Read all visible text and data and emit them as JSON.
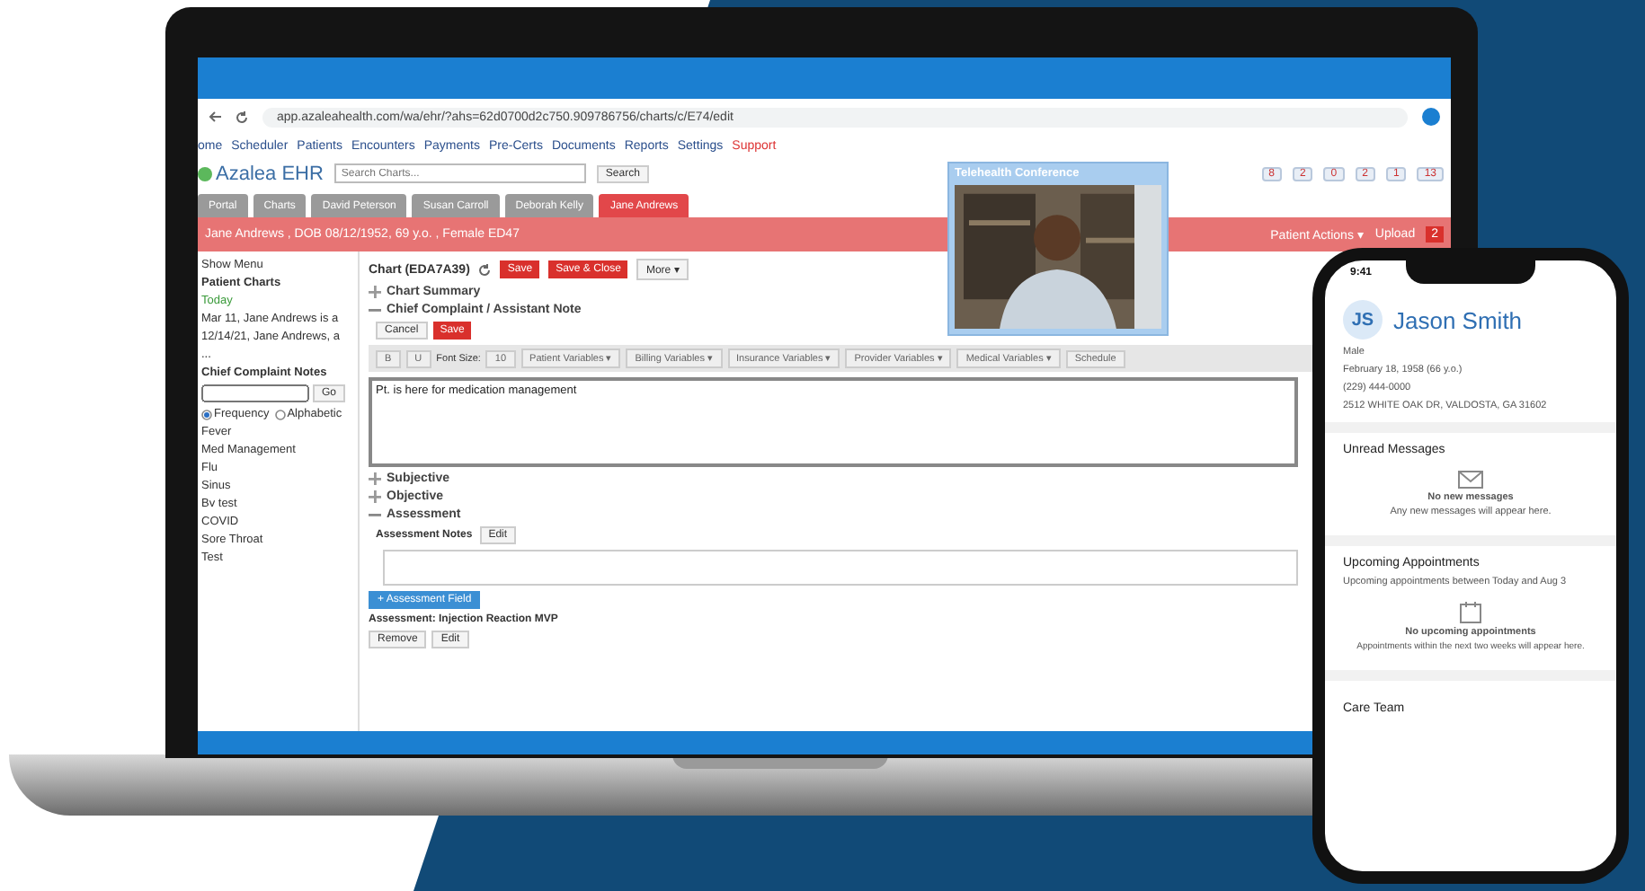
{
  "browser": {
    "url": "app.azaleahealth.com/wa/ehr/?ahs=62d0700d2c750.909786756/charts/c/E74/edit"
  },
  "menu": [
    {
      "label": "ome",
      "alert": false
    },
    {
      "label": "Scheduler",
      "alert": false
    },
    {
      "label": "Patients",
      "alert": false
    },
    {
      "label": "Encounters",
      "alert": false
    },
    {
      "label": "Payments",
      "alert": false
    },
    {
      "label": "Pre-Certs",
      "alert": false
    },
    {
      "label": "Documents",
      "alert": false
    },
    {
      "label": "Reports",
      "alert": false
    },
    {
      "label": "Settings",
      "alert": false
    },
    {
      "label": "Support",
      "alert": true
    }
  ],
  "app": {
    "logo": "Azalea EHR",
    "search_placeholder": "Search Charts...",
    "search_button": "Search"
  },
  "badges": [
    "8",
    "2",
    "0",
    "2",
    "1",
    "13"
  ],
  "tabs": [
    {
      "label": "Portal",
      "selected": false
    },
    {
      "label": "Charts",
      "selected": false
    },
    {
      "label": "David Peterson",
      "selected": false
    },
    {
      "label": "Susan Carroll",
      "selected": false
    },
    {
      "label": "Deborah Kelly",
      "selected": false
    },
    {
      "label": "Jane Andrews",
      "selected": true
    }
  ],
  "patient_bar": {
    "text": "Jane Andrews , DOB 08/12/1952, 69 y.o. , Female  ED47",
    "actions": "Patient Actions ▾",
    "upload": "Upload",
    "count": "2"
  },
  "sidebar": {
    "show_menu": "Show Menu",
    "charts_title": "Patient Charts",
    "charts": [
      "Today",
      "Mar 11, Jane Andrews is a",
      "12/14/21, Jane Andrews, a",
      "..."
    ],
    "notes_title": "Chief Complaint Notes",
    "go": "Go",
    "sort": [
      {
        "label": "Frequency",
        "selected": true
      },
      {
        "label": "Alphabetic",
        "selected": false
      }
    ],
    "notes": [
      "Fever",
      "Med Management",
      "Flu",
      "Sinus",
      "Bv test",
      "COVID",
      "Sore Throat",
      "Test"
    ]
  },
  "chart": {
    "title": "Chart (EDA7A39)",
    "save": "Save",
    "save_close": "Save & Close",
    "more": "More ▾",
    "sections": [
      {
        "title": "Chart Summary",
        "expanded": false
      },
      {
        "title": "Chief Complaint / Assistant Note",
        "expanded": true,
        "kind": "editor"
      },
      {
        "title": "Subjective",
        "expanded": false
      },
      {
        "title": "Objective",
        "expanded": false
      },
      {
        "title": "Assessment",
        "expanded": true,
        "kind": "assessment"
      }
    ],
    "editor": {
      "cancel": "Cancel",
      "save": "Save",
      "bold": "B",
      "underline": "U",
      "font_label": "Font Size:",
      "font_size": "10",
      "variables": [
        "Patient Variables ▾",
        "Billing Variables ▾",
        "Insurance Variables ▾",
        "Provider Variables ▾",
        "Medical Variables ▾",
        "Schedule"
      ],
      "text": "Pt. is here for medication management"
    },
    "assessment": {
      "notes_label": "Assessment Notes",
      "edit": "Edit",
      "add_field": "+ Assessment Field",
      "item": "Assessment: Injection Reaction MVP",
      "remove": "Remove",
      "item_edit": "Edit"
    }
  },
  "video": {
    "title": "Telehealth Conference"
  },
  "phone": {
    "time": "9:41",
    "initials": "JS",
    "name": "Jason Smith",
    "details": [
      "Male",
      "February 18, 1958 (66 y.o.)",
      "(229) 444-0000",
      "2512 WHITE OAK DR, VALDOSTA, GA 31602"
    ],
    "messages": {
      "title": "Unread Messages",
      "empty_title": "No new messages",
      "empty_text": "Any new messages will appear here."
    },
    "appointments": {
      "title": "Upcoming Appointments",
      "subtitle": "Upcoming appointments between Today and Aug 3",
      "empty_title": "No upcoming appointments",
      "empty_text": "Appointments within the next two weeks will appear here."
    },
    "care_team": "Care Team"
  }
}
